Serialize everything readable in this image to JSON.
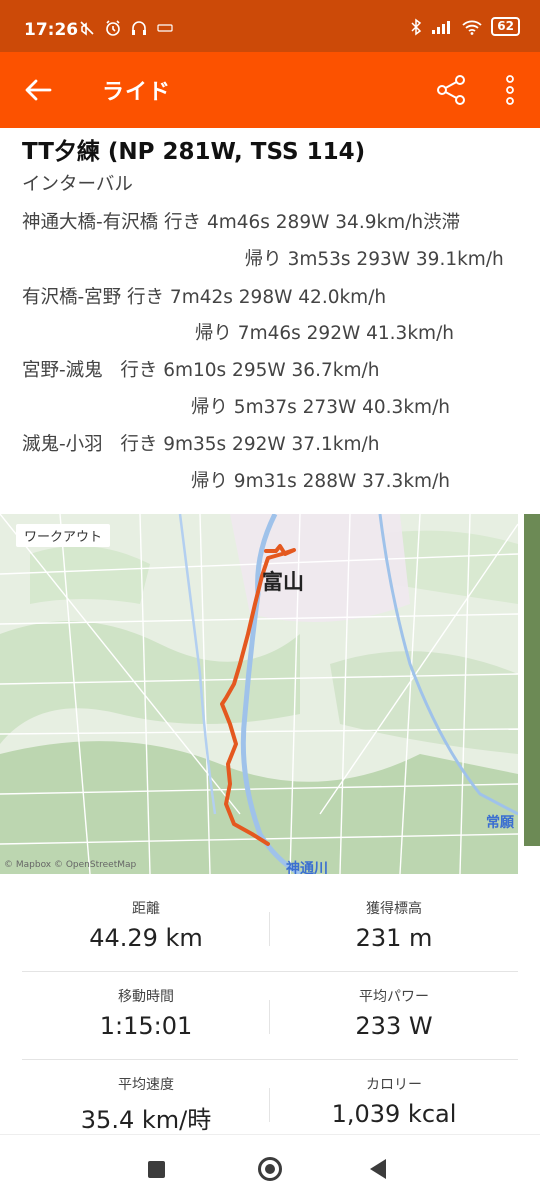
{
  "status_bar": {
    "time": "17:26",
    "left_icons": [
      "mute-icon",
      "alarm-icon",
      "headphones-icon",
      "app-notification-icon"
    ],
    "right_icons": [
      "bluetooth-icon",
      "signal-icon",
      "wifi-icon"
    ],
    "battery": "62"
  },
  "app_bar": {
    "title": "ライド",
    "back_icon": "arrow-left-icon",
    "share_icon": "share-icon",
    "more_icon": "more-vert-icon"
  },
  "activity": {
    "title": "TT夕練 (NP 281W, TSS 114)",
    "description_lines": [
      "インターバル",
      "神通大橋-有沢橋 行き 4m46s 289W 34.9km/h渋滞",
      "           帰り 3m53s 293W 39.1km/h",
      "有沢橋-宮野 行き 7m42s 298W 42.0km/h",
      "         帰り 7m46s 292W 41.3km/h",
      "宮野-滅鬼   行き 6m10s 295W 36.7km/h",
      "         帰り 5m37s 273W 40.3km/h",
      "滅鬼-小羽   行き 9m35s 292W 37.1km/h",
      "         帰り 9m31s 288W 37.3km/h"
    ]
  },
  "map": {
    "tag": "ワークアウト",
    "city_label": "富山",
    "river_label": "神通川",
    "right_label": "常願",
    "attribution": "© Mapbox © OpenStreetMap",
    "route_color": "#e4581f"
  },
  "stats": [
    {
      "label": "距離",
      "value": "44.29 km"
    },
    {
      "label": "獲得標高",
      "value": "231 m"
    },
    {
      "label": "移動時間",
      "value": "1:15:01"
    },
    {
      "label": "平均パワー",
      "value": "233 W"
    },
    {
      "label": "平均速度",
      "value": "35.4 km/時"
    },
    {
      "label": "カロリー",
      "value": "1,039 kcal"
    }
  ],
  "nav_bar": {
    "recent_icon": "recent-apps-icon",
    "home_icon": "home-icon",
    "back_icon": "back-triangle-icon"
  },
  "colors": {
    "status_bar": "#cc4a08",
    "app_bar": "#fc5200",
    "route": "#e4581f"
  }
}
